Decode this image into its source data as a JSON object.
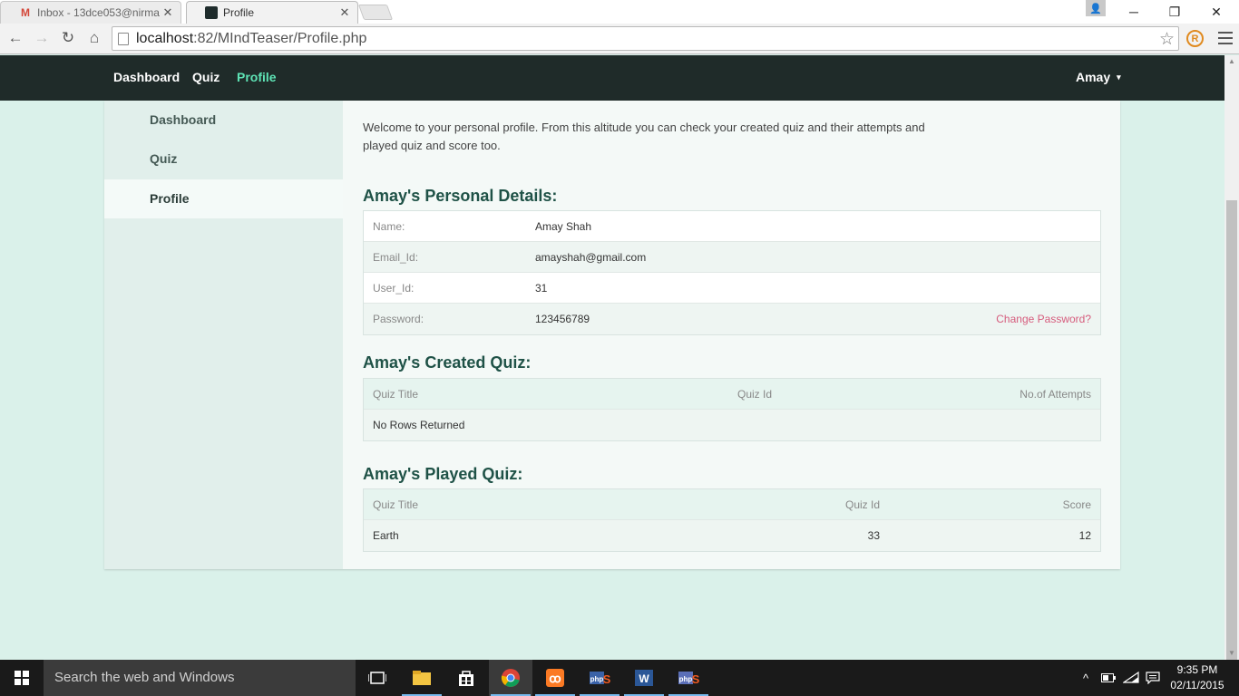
{
  "browser": {
    "tabs": [
      {
        "title": "Inbox - 13dce053@nirma",
        "icon": "gmail-icon",
        "active": false
      },
      {
        "title": "Profile",
        "icon": "site-icon",
        "active": true
      }
    ],
    "url_host": "localhost",
    "url_path": ":82/MIndTeaser/Profile.php"
  },
  "navbar": {
    "links": [
      "Dashboard",
      "Quiz",
      "Profile"
    ],
    "active": "Profile",
    "user": "Amay",
    "caret": "▾"
  },
  "sidebar": {
    "items": [
      "Dashboard",
      "Quiz",
      "Profile"
    ],
    "active": "Profile"
  },
  "main": {
    "intro": "Welcome to your personal profile. From this altitude you can check your created quiz and their attempts and played quiz and score too.",
    "personal": {
      "title": "Amay's Personal Details:",
      "rows": [
        {
          "label": "Name:",
          "value": "Amay Shah"
        },
        {
          "label": "Email_Id:",
          "value": "amayshah@gmail.com"
        },
        {
          "label": "User_Id:",
          "value": "31"
        },
        {
          "label": "Password:",
          "value": "123456789"
        }
      ],
      "change_password": "Change Password?"
    },
    "created": {
      "title": "Amay's Created Quiz:",
      "headers": [
        "Quiz Title",
        "Quiz Id",
        "No.of Attempts"
      ],
      "empty": "No Rows Returned"
    },
    "played": {
      "title": "Amay's Played Quiz:",
      "headers": [
        "Quiz Title",
        "Quiz Id",
        "Score"
      ],
      "rows": [
        {
          "title": "Earth",
          "id": "33",
          "score": "12"
        }
      ]
    }
  },
  "taskbar": {
    "search_placeholder": "Search the web and Windows",
    "time": "9:35 PM",
    "date": "02/11/2015"
  },
  "colors": {
    "navbar_bg": "#1f2b29",
    "nav_active": "#5ee3b5",
    "page_bg": "#daf1ea",
    "heading": "#1f5247",
    "link_pink": "#d65c7d"
  }
}
